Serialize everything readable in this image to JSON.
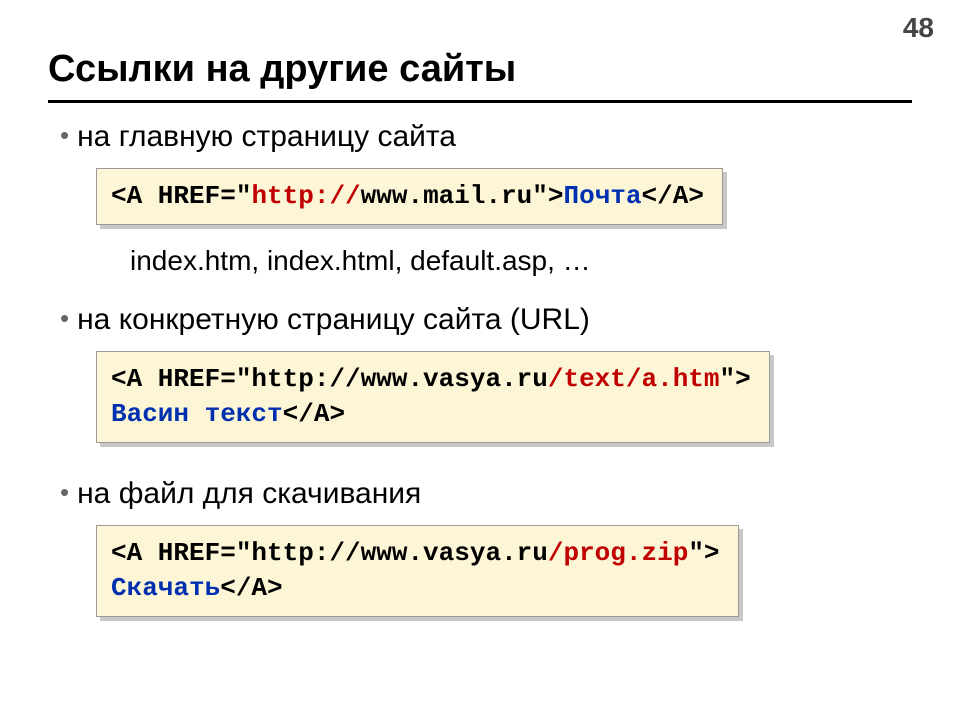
{
  "page_number": "48",
  "title": "Ссылки на другие сайты",
  "bullets": {
    "b1": "на главную страницу сайта",
    "b2": "на конкретную страницу сайта (URL)",
    "b3": "на файл для скачивания"
  },
  "sub_note": "index.htm, index.html, default.asp, …",
  "code1": {
    "p1": "<A HREF=\"",
    "p2": "http://",
    "p3": "www.mail.ru\">",
    "p4": "Почта",
    "p5": "</A>"
  },
  "code2": {
    "p1": "<A HREF=\"http://www.vasya.ru",
    "p2": "/text/a.htm",
    "p3": "\">",
    "nl": "\n",
    "p4": "Васин текст",
    "p5": "</A>"
  },
  "code3": {
    "p1": "<A HREF=\"http://www.vasya.ru",
    "p2": "/prog.zip",
    "p3": "\">",
    "nl": "\n",
    "p4": "Скачать",
    "p5": "</A>"
  }
}
